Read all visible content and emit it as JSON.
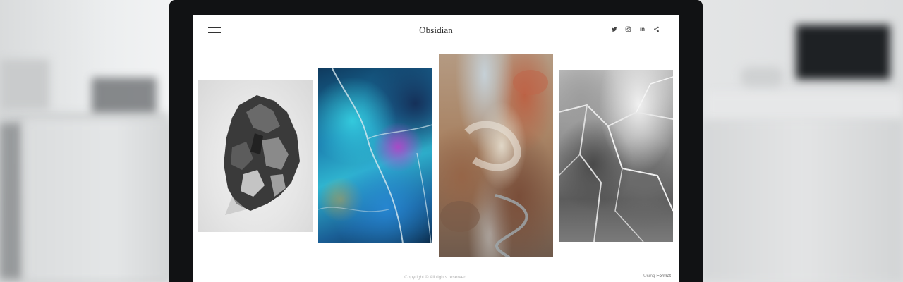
{
  "site": {
    "title": "Obsidian"
  },
  "header": {
    "social_icons": [
      "twitter-icon",
      "instagram-icon",
      "linkedin-icon",
      "share-icon"
    ],
    "linkedin_glyph": "in"
  },
  "gallery": {
    "photos": [
      {
        "name": "grayscale crystal",
        "tone": "#9a9a9a"
      },
      {
        "name": "blue mineral",
        "tone": "#1c7fb0"
      },
      {
        "name": "aerial desert",
        "tone": "#a98465"
      },
      {
        "name": "grayscale ice",
        "tone": "#8a8a8a"
      }
    ]
  },
  "footer": {
    "copyright": "Copyright © All rights reserved.",
    "using_prefix": "Using ",
    "using_link": "Format"
  }
}
